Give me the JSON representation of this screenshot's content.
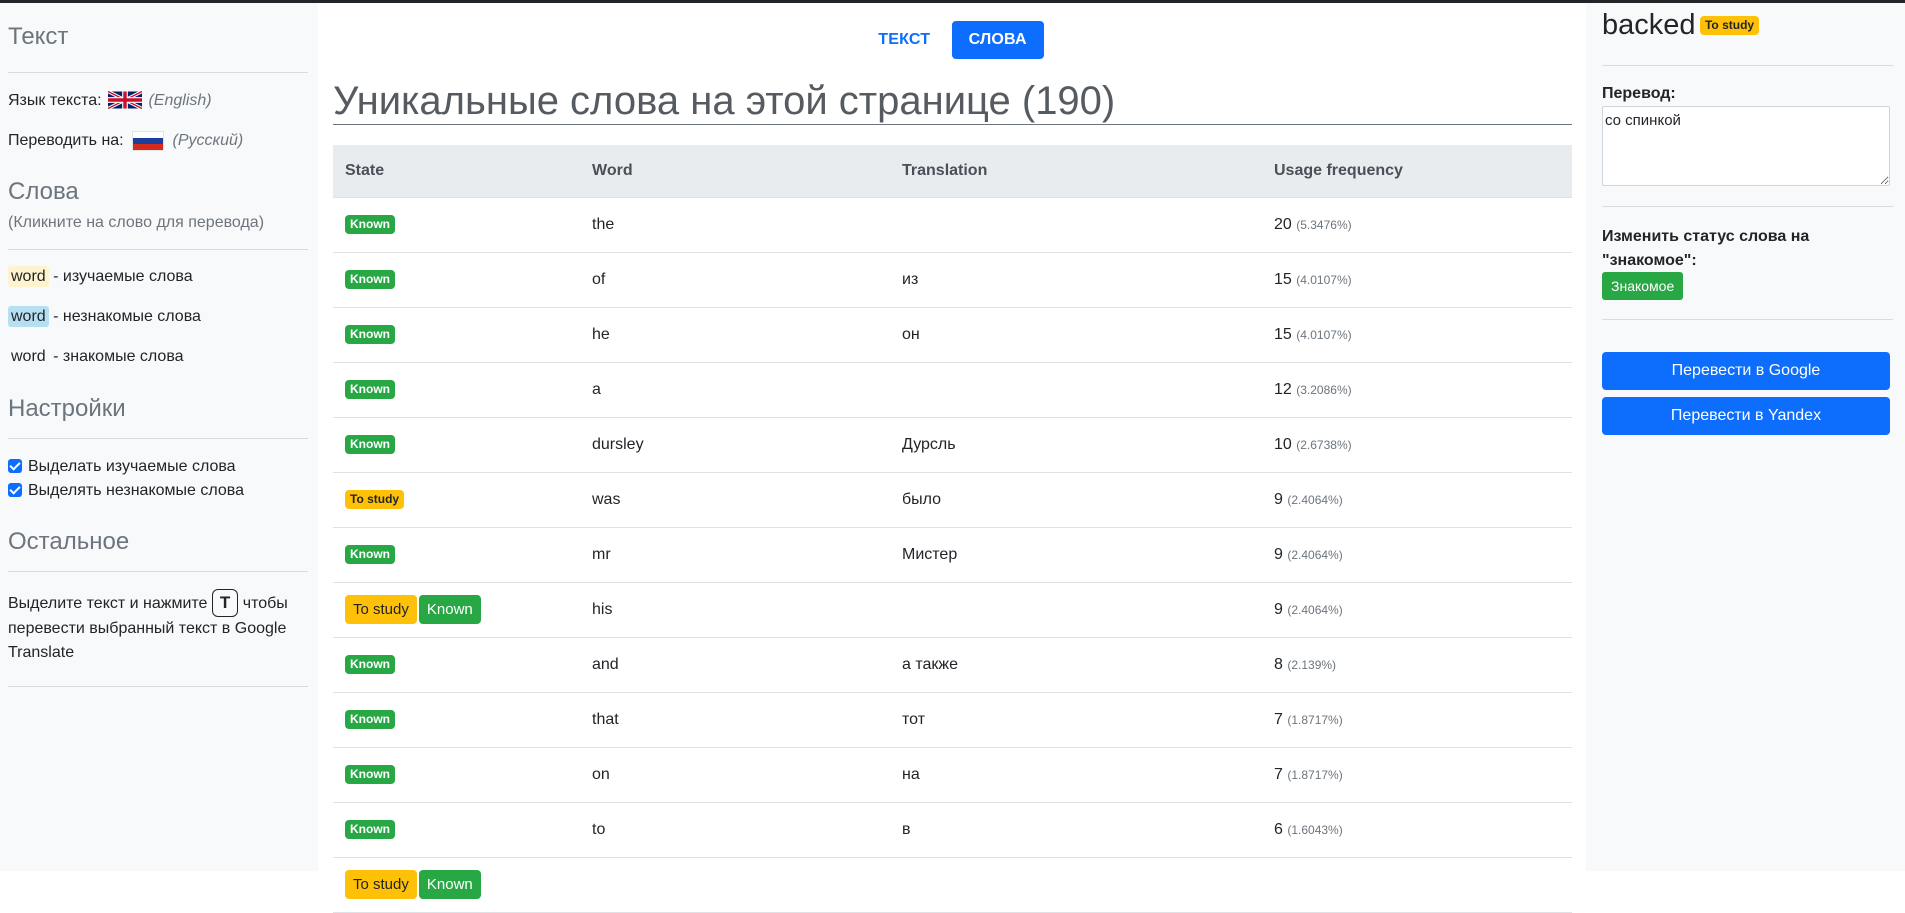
{
  "sidebar": {
    "text_title": "Текст",
    "lang_label": "Язык текста:",
    "lang_value": "(English)",
    "translate_label": "Переводить на:",
    "translate_value": "(Русский)",
    "words_title": "Слова",
    "words_hint": "(Кликните на слово для перевода)",
    "legend": [
      {
        "chip": "word",
        "text": "- изучаемые слова"
      },
      {
        "chip": "word",
        "text": "- незнакомые слова"
      },
      {
        "chip": "word",
        "text": "- знакомые слова"
      }
    ],
    "settings_title": "Настройки",
    "settings": [
      {
        "label": "Выделать изучаемые слова",
        "checked": true
      },
      {
        "label": "Выделять незнакомые слова",
        "checked": true
      }
    ],
    "other_title": "Остальное",
    "other_text_before": "Выделите текст и нажмите",
    "other_key": "T",
    "other_text_after": "чтобы перевести выбранный текст в Google Translate"
  },
  "main": {
    "tabs": {
      "text": "ТЕКСТ",
      "words": "СЛОВА"
    },
    "heading": "Уникальные слова на этой странице (190)",
    "columns": [
      "State",
      "Word",
      "Translation",
      "Usage frequency"
    ],
    "rows": [
      {
        "states": [
          "Known"
        ],
        "word": "the",
        "translation": "",
        "count": "20",
        "pct": "(5.3476%)"
      },
      {
        "states": [
          "Known"
        ],
        "word": "of",
        "translation": "из",
        "count": "15",
        "pct": "(4.0107%)"
      },
      {
        "states": [
          "Known"
        ],
        "word": "he",
        "translation": "он",
        "count": "15",
        "pct": "(4.0107%)"
      },
      {
        "states": [
          "Known"
        ],
        "word": "a",
        "translation": "",
        "count": "12",
        "pct": "(3.2086%)"
      },
      {
        "states": [
          "Known"
        ],
        "word": "dursley",
        "translation": "Дурсль",
        "count": "10",
        "pct": "(2.6738%)"
      },
      {
        "states": [
          "To study"
        ],
        "word": "was",
        "translation": "было",
        "count": "9",
        "pct": "(2.4064%)"
      },
      {
        "states": [
          "Known"
        ],
        "word": "mr",
        "translation": "Мистер",
        "count": "9",
        "pct": "(2.4064%)"
      },
      {
        "states": [
          "To study",
          "Known"
        ],
        "word": "his",
        "translation": "",
        "count": "9",
        "pct": "(2.4064%)"
      },
      {
        "states": [
          "Known"
        ],
        "word": "and",
        "translation": "а также",
        "count": "8",
        "pct": "(2.139%)"
      },
      {
        "states": [
          "Known"
        ],
        "word": "that",
        "translation": "тот",
        "count": "7",
        "pct": "(1.8717%)"
      },
      {
        "states": [
          "Known"
        ],
        "word": "on",
        "translation": "на",
        "count": "7",
        "pct": "(1.8717%)"
      },
      {
        "states": [
          "Known"
        ],
        "word": "to",
        "translation": "в",
        "count": "6",
        "pct": "(1.6043%)"
      },
      {
        "states": [
          "To study",
          "Known"
        ],
        "word": "",
        "translation": "",
        "count": "",
        "pct": ""
      }
    ]
  },
  "panel": {
    "word": "backed",
    "badge": "To study",
    "translation_label": "Перевод:",
    "translation_value": "со спинкой",
    "change_status_label": "Изменить статус слова на \"знакомое\":",
    "known_button": "Знакомое",
    "google_button": "Перевести в Google",
    "yandex_button": "Перевести в Yandex"
  },
  "colors": {
    "primary": "#0d6efd",
    "known": "#28a745",
    "study": "#ffc107",
    "sidebar_bg": "#f8f9fa"
  }
}
